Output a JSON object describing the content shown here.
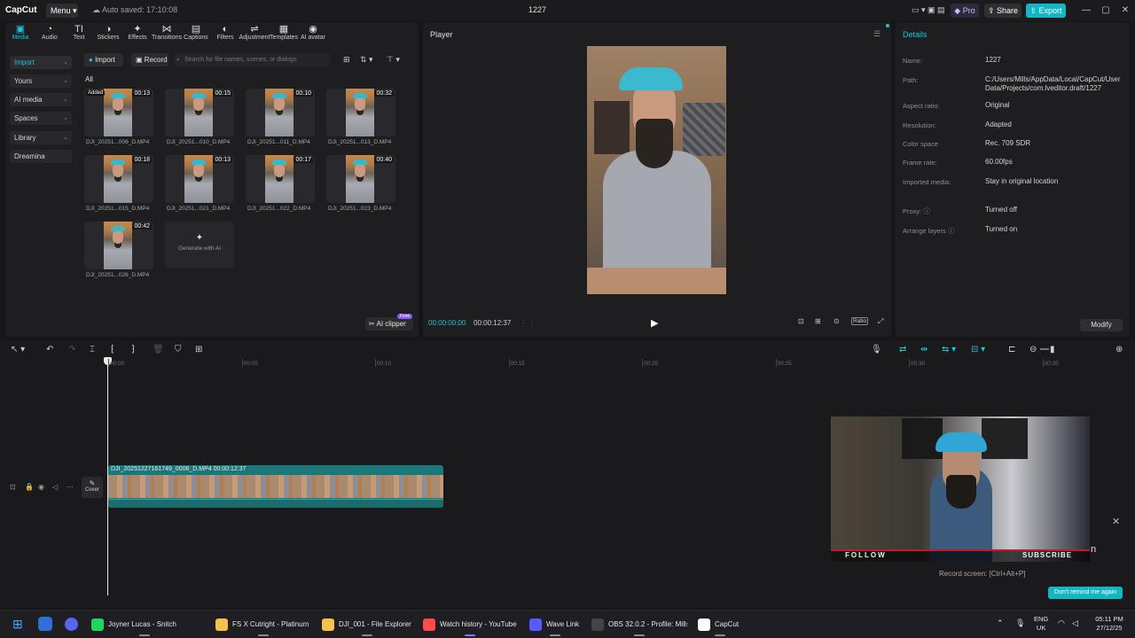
{
  "titlebar": {
    "logo": "CapCut",
    "menu": "Menu",
    "autosave": "Auto saved: 17:10:08",
    "project": "1227",
    "pro": "Pro",
    "share": "Share",
    "export": "Export",
    "minimize": "—",
    "maximize": "▢",
    "close": "✕"
  },
  "tools": [
    {
      "label": "Media",
      "icon": "▣"
    },
    {
      "label": "Audio",
      "icon": "◔"
    },
    {
      "label": "Text",
      "icon": "TI"
    },
    {
      "label": "Stickers",
      "icon": "◑"
    },
    {
      "label": "Effects",
      "icon": "✦"
    },
    {
      "label": "Transitions",
      "icon": "⋈"
    },
    {
      "label": "Captions",
      "icon": "▤"
    },
    {
      "label": "Filters",
      "icon": "◐"
    },
    {
      "label": "Adjustment",
      "icon": "⇌"
    },
    {
      "label": "Templates",
      "icon": "▦"
    },
    {
      "label": "AI avatar",
      "icon": "◉"
    }
  ],
  "nav": [
    "Import",
    "Yours",
    "AI media",
    "Spaces",
    "Library",
    "Dreamina"
  ],
  "media_toolbar": {
    "import": "Import",
    "record": "Record",
    "search_placeholder": "Search for file names, scenes, or dialogs",
    "all": "All"
  },
  "clips": [
    {
      "name": "DJI_20251...006_D.MP4",
      "dur": "00:13",
      "added": "Added"
    },
    {
      "name": "DJI_20251...010_D.MP4",
      "dur": "00:15"
    },
    {
      "name": "DJI_20251...011_D.MP4",
      "dur": "00:10"
    },
    {
      "name": "DJI_20251...013_D.MP4",
      "dur": "00:32"
    },
    {
      "name": "DJI_20251...015_D.MP4",
      "dur": "00:18"
    },
    {
      "name": "DJI_20251...021_D.MP4",
      "dur": "00:13"
    },
    {
      "name": "DJI_20251...022_D.MP4",
      "dur": "00:17"
    },
    {
      "name": "DJI_20251...023_D.MP4",
      "dur": "00:40"
    },
    {
      "name": "DJI_20251...026_D.MP4",
      "dur": "00:42"
    }
  ],
  "generate_ai": "Generate with AI",
  "ai_clipper": "AI clipper",
  "free": "Free",
  "player": {
    "title": "Player",
    "current": "00:00:00:00",
    "total": "00:00:12:37",
    "ratio": "Ratio"
  },
  "details": {
    "title": "Details",
    "rows": [
      {
        "k": "Name:",
        "v": "1227"
      },
      {
        "k": "Path:",
        "v": "C:/Users/Mills/AppData/Local/CapCut/User Data/Projects/com.lveditor.draft/1227"
      },
      {
        "k": "Aspect ratio:",
        "v": "Original"
      },
      {
        "k": "Resolution:",
        "v": "Adapted"
      },
      {
        "k": "Color space",
        "v": "Rec. 709 SDR"
      },
      {
        "k": "Frame rate:",
        "v": "60.00fps"
      },
      {
        "k": "Imported media:",
        "v": "Stay in original location"
      },
      {
        "k": "Proxy: ⓘ",
        "v": "Turned off"
      },
      {
        "k": "Arrange layers ⓘ",
        "v": "Turned on"
      }
    ],
    "modify": "Modify"
  },
  "timeline": {
    "ruler": [
      "00:00",
      "00:05",
      "00:10",
      "00:15",
      "00:20",
      "00:25",
      "00:30",
      "00:35"
    ],
    "track_label": "DJI_20251227161749_0006_D.MP4   00:00:12:37",
    "cover": "Cover"
  },
  "webcam": {
    "follow": "FOLLOW",
    "subscribe": "SUBSCRIBE"
  },
  "toast": {
    "rec_screen": "Record screen: [Ctrl+Alt+P]",
    "dont_remind": "Don't remind me again",
    "letter": "n"
  },
  "taskbar": {
    "apps": [
      {
        "label": "Joyner Lucas - Snitch",
        "color": "#1ed760"
      },
      {
        "label": "FS X Cutright - Platinum",
        "color": "#f2c14e"
      },
      {
        "label": "DJI_001 - File Explorer",
        "color": "#f2c14e"
      },
      {
        "label": "Watch history - YouTube",
        "color": "#ff4b4b"
      },
      {
        "label": "Wave Link",
        "color": "#5a5aff"
      },
      {
        "label": "OBS 32.0.2 - Profile: Mills",
        "color": "#444"
      },
      {
        "label": "CapCut",
        "color": "#ffffff"
      }
    ],
    "lang": "ENG",
    "region": "UK",
    "time": "05:11 PM",
    "date": "27/12/25"
  },
  "colors": {
    "accent": "#20c5d6",
    "export": "#14b6c4"
  }
}
